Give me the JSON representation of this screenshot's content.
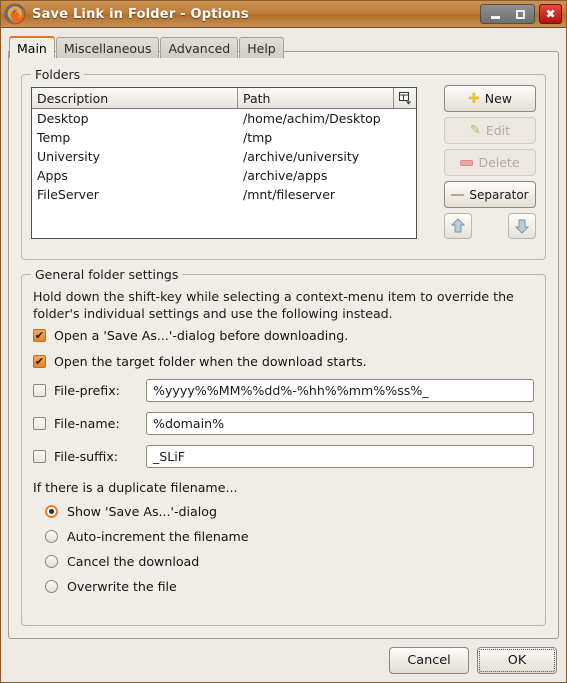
{
  "window": {
    "title": "Save Link in Folder - Options",
    "app_icon": "firefox-logo-icon",
    "minimize_label": "Minimize",
    "maximize_label": "Maximize",
    "close_label": "✖"
  },
  "tabs": [
    {
      "label": "Main",
      "active": true
    },
    {
      "label": "Miscellaneous",
      "active": false
    },
    {
      "label": "Advanced",
      "active": false
    },
    {
      "label": "Help",
      "active": false
    }
  ],
  "folders_group": {
    "title": "Folders",
    "columns": [
      "Description",
      "Path"
    ],
    "column_selector_icon": "column-chooser-icon",
    "rows": [
      {
        "description": "Desktop",
        "path": "/home/achim/Desktop"
      },
      {
        "description": "Temp",
        "path": "/tmp"
      },
      {
        "description": "University",
        "path": "/archive/university"
      },
      {
        "description": "Apps",
        "path": "/archive/apps"
      },
      {
        "description": "FileServer",
        "path": "/mnt/fileserver"
      }
    ],
    "buttons": {
      "new": "New",
      "edit": "Edit",
      "delete": "Delete",
      "separator": "Separator",
      "move_up": "move-up-icon",
      "move_down": "move-down-icon"
    }
  },
  "general_group": {
    "title": "General folder settings",
    "description": "Hold down the shift-key while selecting a context-menu item to override the folder's individual settings and use the following instead.",
    "checkboxes": [
      {
        "label": "Open a 'Save As...'-dialog before downloading.",
        "checked": true
      },
      {
        "label": "Open the target folder when the download starts.",
        "checked": true
      }
    ],
    "fields": [
      {
        "label": "File-prefix:",
        "value": "%yyyy%%MM%%dd%-%hh%%mm%%ss%_",
        "checked": false
      },
      {
        "label": "File-name:",
        "value": "%domain%",
        "checked": false
      },
      {
        "label": "File-suffix:",
        "value": "_SLiF",
        "checked": false
      }
    ],
    "duplicate_title": "If there is a duplicate filename...",
    "duplicate_options": [
      {
        "label": "Show 'Save As...'-dialog",
        "selected": true
      },
      {
        "label": "Auto-increment the filename",
        "selected": false
      },
      {
        "label": "Cancel the download",
        "selected": false
      },
      {
        "label": "Overwrite the file",
        "selected": false
      }
    ]
  },
  "footer": {
    "cancel": "Cancel",
    "ok": "OK"
  },
  "colors": {
    "titlebar": "#bd7b35",
    "accent": "#e8702a",
    "panel_bg": "#f0ece6",
    "close_button": "#b5120c"
  }
}
